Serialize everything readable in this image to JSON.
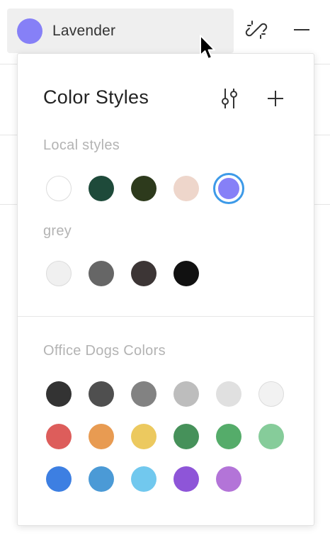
{
  "selected_style": {
    "name": "Lavender",
    "color": "#8680f7"
  },
  "panel": {
    "title": "Color Styles",
    "groups": [
      {
        "label": "Local styles",
        "swatches": [
          "#ffffff",
          "#1e4a3a",
          "#2d3a1c",
          "#eed6cb",
          "#8680f7"
        ],
        "selected_index": 4
      },
      {
        "label": "grey",
        "swatches": [
          "#f0f0f0",
          "#666666",
          "#3c3535",
          "#111111"
        ]
      }
    ],
    "library": {
      "label": "Office Dogs Colors",
      "rows": [
        [
          "#333333",
          "#4f4f4f",
          "#828282",
          "#bdbdbd",
          "#e0e0e0",
          "#f2f2f2"
        ],
        [
          "#dd5d5b",
          "#e89b52",
          "#ecc95f",
          "#46915a",
          "#55ac6a",
          "#86cc9a"
        ],
        [
          "#3d7fe2",
          "#4b9ad6",
          "#71c8ee",
          "#8e55d8",
          "#b374d8"
        ]
      ]
    }
  },
  "icons": {
    "detach": "unlink-icon",
    "minus": "minus-icon",
    "adjust": "sliders-icon",
    "add": "plus-icon",
    "cursor": "pointer-cursor"
  }
}
